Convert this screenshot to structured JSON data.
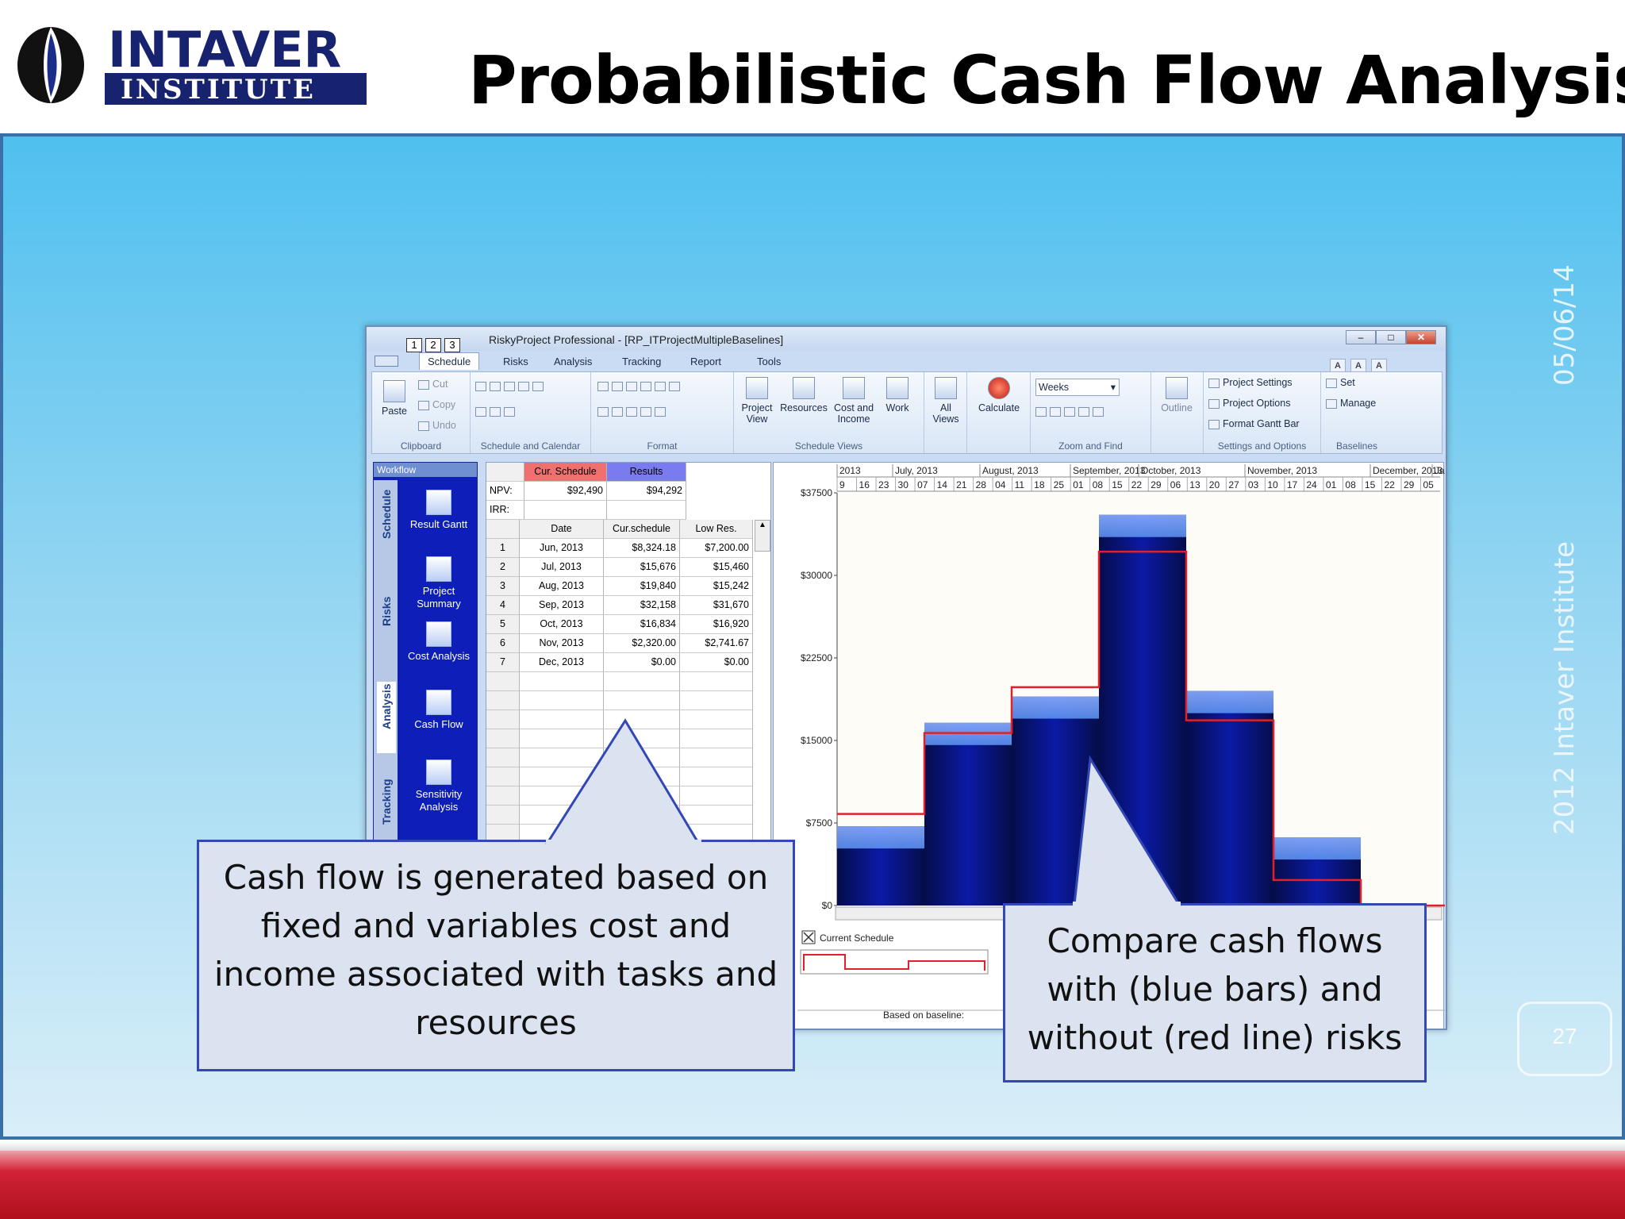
{
  "header": {
    "logo_line1": "INTAVER",
    "logo_line2": "INSTITUTE",
    "title": "Probabilistic Cash Flow Analysis"
  },
  "side": {
    "date": "05/06/14",
    "copyright": "2012 Intaver Institute",
    "page": "27"
  },
  "app": {
    "title": "RiskyProject Professional - [RP_ITProjectMultipleBaselines]",
    "quick_buttons": [
      "1",
      "2",
      "3"
    ],
    "tabs": [
      "Schedule",
      "Risks",
      "Analysis",
      "Tracking",
      "Report",
      "Tools"
    ],
    "ribbon": {
      "clipboard": {
        "label": "Clipboard",
        "paste": "Paste",
        "cut": "Cut",
        "copy": "Copy",
        "undo": "Undo"
      },
      "schedule_calendar": {
        "label": "Schedule and Calendar"
      },
      "format": {
        "label": "Format"
      },
      "views": {
        "label": "Schedule Views",
        "project_view": "Project View",
        "resources": "Resources",
        "cost_income": "Cost and Income",
        "work": "Work"
      },
      "all_views": "All Views",
      "calculate": "Calculate",
      "zoom": {
        "label": "Zoom and Find",
        "scale": "Weeks"
      },
      "outline": "Outline",
      "settings": {
        "label": "Settings and Options",
        "project_settings": "Project Settings",
        "project_options": "Project Options",
        "format_gantt": "Format Gantt Bar"
      },
      "baselines": {
        "label": "Baselines",
        "set": "Set",
        "manage": "Manage"
      },
      "font_buttons": [
        "A",
        "A",
        "A"
      ]
    },
    "workflow": {
      "header": "Workflow",
      "tabs": [
        "Schedule",
        "Risks",
        "Analysis",
        "Tracking"
      ],
      "items": [
        "Result Gantt",
        "Project Summary",
        "Cost Analysis",
        "Cash Flow",
        "Sensitivity Analysis"
      ]
    },
    "summary": {
      "col_cur": "Cur. Schedule",
      "col_results": "Results",
      "npv_label": "NPV:",
      "irr_label": "IRR:",
      "npv_cur": "$92,490",
      "npv_results": "$94,292"
    },
    "table": {
      "headers": [
        "Date",
        "Cur.schedule",
        "Low Res."
      ],
      "rows": [
        [
          "1",
          "Jun, 2013",
          "$8,324.18",
          "$7,200.00"
        ],
        [
          "2",
          "Jul, 2013",
          "$15,676",
          "$15,460"
        ],
        [
          "3",
          "Aug, 2013",
          "$19,840",
          "$15,242"
        ],
        [
          "4",
          "Sep, 2013",
          "$32,158",
          "$31,670"
        ],
        [
          "5",
          "Oct, 2013",
          "$16,834",
          "$16,920"
        ],
        [
          "6",
          "Nov, 2013",
          "$2,320.00",
          "$2,741.67"
        ],
        [
          "7",
          "Dec, 2013",
          "$0.00",
          "$0.00"
        ]
      ]
    },
    "chart_data": {
      "type": "bar",
      "months": [
        "2013",
        "July, 2013",
        "August, 2013",
        "September, 2013",
        "October, 2013",
        "November, 2013",
        "December, 2013",
        "Janu"
      ],
      "days": [
        "9",
        "16",
        "23",
        "30",
        "07",
        "14",
        "21",
        "28",
        "04",
        "11",
        "18",
        "25",
        "01",
        "08",
        "15",
        "22",
        "29",
        "06",
        "13",
        "20",
        "27",
        "03",
        "10",
        "17",
        "24",
        "01",
        "08",
        "15",
        "22",
        "29",
        "05"
      ],
      "y_ticks": [
        "$37500",
        "$30000",
        "$22500",
        "$15000",
        "$7500",
        "$0"
      ],
      "ylim": [
        0,
        37500
      ],
      "series": [
        {
          "values": [
            7200,
            16600,
            19000,
            35500,
            19500,
            6200,
            0
          ]
        },
        {
          "values": [
            8324.18,
            15676,
            19840,
            32158,
            16834,
            2320,
            0
          ]
        }
      ],
      "legend": "Current Schedule",
      "baseline_label": "Based on baseline:",
      "colors": {
        "bars": "#0b1aa6",
        "bar_top": "#5b8ff0",
        "line": "#e0202a"
      }
    }
  },
  "callouts": {
    "left": [
      "Cash flow is generated based on",
      "fixed and variables cost and",
      "income associated with tasks and",
      "resources"
    ],
    "right": [
      "Compare cash flows",
      "with (blue bars) and",
      "without (red line) risks"
    ]
  }
}
